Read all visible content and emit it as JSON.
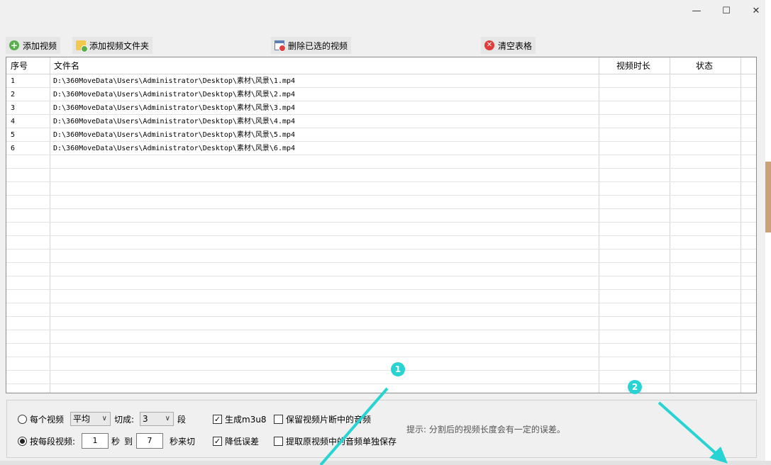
{
  "window": {
    "minimize": "—",
    "maximize": "☐",
    "close": "✕"
  },
  "toolbar": {
    "add_video": "添加视频",
    "add_folder": "添加视频文件夹",
    "delete_selected": "删除已选的视频",
    "clear_table": "清空表格"
  },
  "table": {
    "headers": {
      "index": "序号",
      "filename": "文件名",
      "duration": "视频时长",
      "status": "状态"
    },
    "rows": [
      {
        "index": "1",
        "filename": "D:\\360MoveData\\Users\\Administrator\\Desktop\\素材\\风景\\1.mp4",
        "duration": "",
        "status": ""
      },
      {
        "index": "2",
        "filename": "D:\\360MoveData\\Users\\Administrator\\Desktop\\素材\\风景\\2.mp4",
        "duration": "",
        "status": ""
      },
      {
        "index": "3",
        "filename": "D:\\360MoveData\\Users\\Administrator\\Desktop\\素材\\风景\\3.mp4",
        "duration": "",
        "status": ""
      },
      {
        "index": "4",
        "filename": "D:\\360MoveData\\Users\\Administrator\\Desktop\\素材\\风景\\4.mp4",
        "duration": "",
        "status": ""
      },
      {
        "index": "5",
        "filename": "D:\\360MoveData\\Users\\Administrator\\Desktop\\素材\\风景\\5.mp4",
        "duration": "",
        "status": ""
      },
      {
        "index": "6",
        "filename": "D:\\360MoveData\\Users\\Administrator\\Desktop\\素材\\风景\\6.mp4",
        "duration": "",
        "status": ""
      }
    ]
  },
  "options": {
    "per_video_label": "每个视频",
    "mode_select": "平均",
    "cut_into_label": "切成:",
    "segments_select": "3",
    "segments_unit": "段",
    "per_segment_label": "按每段视频:",
    "from_value": "1",
    "seconds_label": "秒",
    "to_label": "到",
    "to_value": "7",
    "seconds_cut_label": "秒来切",
    "gen_m3u8": "生成m3u8",
    "reduce_error": "降低误差",
    "keep_audio": "保留视频片断中的音频",
    "extract_audio": "提取原视频中的音频单独保存",
    "tip": "提示: 分割后的视频长度会有一定的误差。"
  },
  "annotations": {
    "badge1": "1",
    "badge2": "2",
    "color": "#27d3d3"
  }
}
